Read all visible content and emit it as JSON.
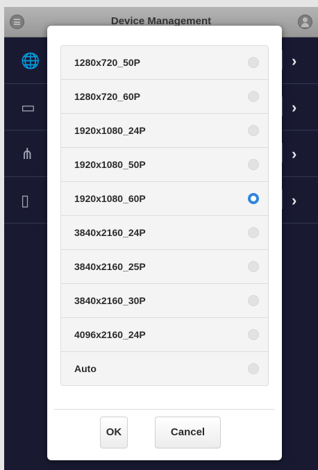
{
  "header": {
    "title": "Device Management",
    "menu_icon": "menu-icon",
    "user_icon": "user-icon"
  },
  "background_rows": [
    {
      "icon": "globe-icon",
      "glyph": "🌐"
    },
    {
      "icon": "monitor-icon",
      "glyph": "▭"
    },
    {
      "icon": "network-icon",
      "glyph": "⋔"
    },
    {
      "icon": "storage-icon",
      "glyph": "▯"
    }
  ],
  "dialog": {
    "options": [
      {
        "label": "1280x720_50P",
        "selected": false
      },
      {
        "label": "1280x720_60P",
        "selected": false
      },
      {
        "label": "1920x1080_24P",
        "selected": false
      },
      {
        "label": "1920x1080_50P",
        "selected": false
      },
      {
        "label": "1920x1080_60P",
        "selected": true
      },
      {
        "label": "3840x2160_24P",
        "selected": false
      },
      {
        "label": "3840x2160_25P",
        "selected": false
      },
      {
        "label": "3840x2160_30P",
        "selected": false
      },
      {
        "label": "4096x2160_24P",
        "selected": false
      },
      {
        "label": "Auto",
        "selected": false
      }
    ],
    "ok_label": "OK",
    "cancel_label": "Cancel"
  },
  "colors": {
    "accent": "#2f86de",
    "background": "#1c1e38"
  }
}
